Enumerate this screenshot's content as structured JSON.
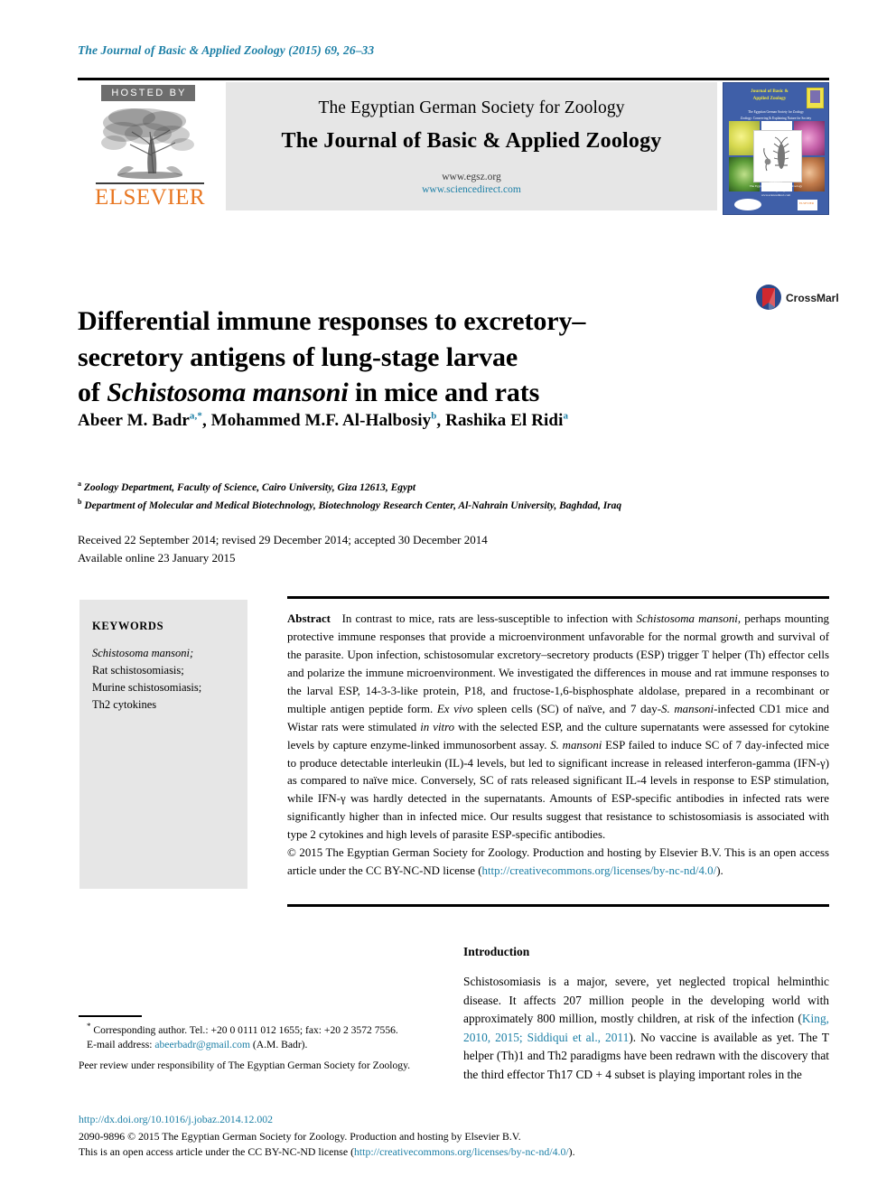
{
  "running_head": "The Journal of Basic & Applied Zoology (2015) 69, 26–33",
  "masthead": {
    "hosted_by_label": "HOSTED BY",
    "publisher_name": "ELSEVIER",
    "society_name": "The Egyptian German Society for Zoology",
    "journal_name": "The Journal of Basic & Applied Zoology",
    "society_url": "www.egsz.org",
    "sciencedirect_url": "www.sciencedirect.com",
    "cover": {
      "title_line1": "Journal of Basic &",
      "title_line2": "Applied Zoology",
      "subtitle": "The Egyptian German Society for Zoology",
      "tagline": "Zoology: Conserving & Explaining Nature for Society",
      "footer_line1": "Hosted by",
      "footer_line2": "The Egyptian German Society for Zoology",
      "footer_line3": "www.egsz.org",
      "footer_line4": "www.sciencedirect.com",
      "publisher_mark": "ELSEVIER"
    }
  },
  "article": {
    "title_line1": "Differential immune responses to excretory–",
    "title_line2": "secretory antigens of lung-stage larvae",
    "title_line3_prefix": "of ",
    "title_line3_italic": "Schistosoma mansoni",
    "title_line3_suffix": " in mice and rats",
    "crossmark_label": "CrossMark",
    "authors": [
      {
        "name": "Abeer M. Badr",
        "marks": "a,*"
      },
      {
        "name": "Mohammed M.F. Al-Halbosiy",
        "marks": "b"
      },
      {
        "name": "Rashika El Ridi",
        "marks": "a"
      }
    ],
    "affiliations": [
      {
        "mark": "a",
        "text": "Zoology Department, Faculty of Science, Cairo University, Giza 12613, Egypt"
      },
      {
        "mark": "b",
        "text": "Department of Molecular and Medical Biotechnology, Biotechnology Research Center, Al-Nahrain University, Baghdad, Iraq"
      }
    ],
    "dates_line1": "Received 22 September 2014; revised 29 December 2014; accepted 30 December 2014",
    "dates_line2": "Available online 23 January 2015"
  },
  "keywords": {
    "heading": "KEYWORDS",
    "items": [
      {
        "text": "Schistosoma mansoni;",
        "italic": true
      },
      {
        "text": "Rat schistosomiasis;",
        "italic": false
      },
      {
        "text": "Murine schistosomiasis;",
        "italic": false
      },
      {
        "text": "Th2 cytokines",
        "italic": false
      }
    ]
  },
  "abstract": {
    "label": "Abstract",
    "body_1": "In contrast to mice, rats are less-susceptible to infection with ",
    "body_italic_1": "Schistosoma mansoni",
    "body_2": ", perhaps mounting protective immune responses that provide a microenvironment unfavorable for the normal growth and survival of the parasite. Upon infection, schistosomular excretory–secretory products (ESP) trigger T helper (Th) effector cells and polarize the immune microenvironment. We investigated the differences in mouse and rat immune responses to the larval ESP, 14-3-3-like protein, P18, and fructose-1,6-bisphosphate aldolase, prepared in a recombinant or multiple antigen peptide form. ",
    "body_italic_2": "Ex vivo",
    "body_3": " spleen cells (SC) of naïve, and 7 day-",
    "body_italic_3": "S. mansoni",
    "body_4": "-infected CD1 mice and Wistar rats were stimulated ",
    "body_italic_4": "in vitro",
    "body_5": " with the selected ESP, and the culture supernatants were assessed for cytokine levels by capture enzyme-linked immunosorbent assay. ",
    "body_italic_5": "S. mansoni",
    "body_6": " ESP failed to induce SC of 7 day-infected mice to produce detectable interleukin (IL)-4 levels, but led to significant increase in released interferon-gamma (IFN-γ) as compared to naïve mice. Conversely, SC of rats released significant IL-4 levels in response to ESP stimulation, while IFN-γ was hardly detected in the supernatants. Amounts of ESP-specific antibodies in infected rats were significantly higher than in infected mice. Our results suggest that resistance to schistosomiasis is associated with type 2 cytokines and high levels of parasite ESP-specific antibodies.",
    "copyright_1": "© 2015 The Egyptian German Society for Zoology. Production and hosting by Elsevier B.V.  This is an open access article under the CC BY-NC-ND license (",
    "copyright_link": "http://creativecommons.org/licenses/by-nc-nd/4.0/",
    "copyright_2": ")."
  },
  "introduction": {
    "heading": "Introduction",
    "para_1": "Schistosomiasis is a major, severe, yet neglected tropical helminthic disease. It affects 207 million people in the developing world with approximately 800 million, mostly children, at risk of the infection (",
    "citation": "King, 2010, 2015; Siddiqui et al., 2011",
    "para_2": "). No vaccine is available as yet. The T helper (Th)1 and Th2 paradigms have been redrawn with the discovery that the third effector Th17 CD + 4 subset is playing important roles in the"
  },
  "footnotes": {
    "corresponding": "Corresponding author. Tel.: +20 0 0111 012 1655; fax: +20 2 3572 7556.",
    "email_label": "E-mail address:",
    "email": "abeerbadr@gmail.com",
    "email_suffix": "(A.M. Badr).",
    "peer_review": "Peer review under responsibility of The Egyptian German Society for Zoology."
  },
  "footer": {
    "doi": "http://dx.doi.org/10.1016/j.jobaz.2014.12.002",
    "issn_line": "2090-9896 © 2015 The Egyptian German Society for Zoology. Production and hosting by Elsevier B.V.",
    "license_prefix": "This is an open access article under the CC BY-NC-ND license (",
    "license_link": "http://creativecommons.org/licenses/by-nc-nd/4.0/",
    "license_suffix": ")."
  },
  "colors": {
    "link": "#1c7fa6",
    "elsevier_orange": "#e87722",
    "hosted_by_bg": "#6d6d6d",
    "banner_bg": "#e6e6e6",
    "cover_bg": "#3f5fa8"
  }
}
